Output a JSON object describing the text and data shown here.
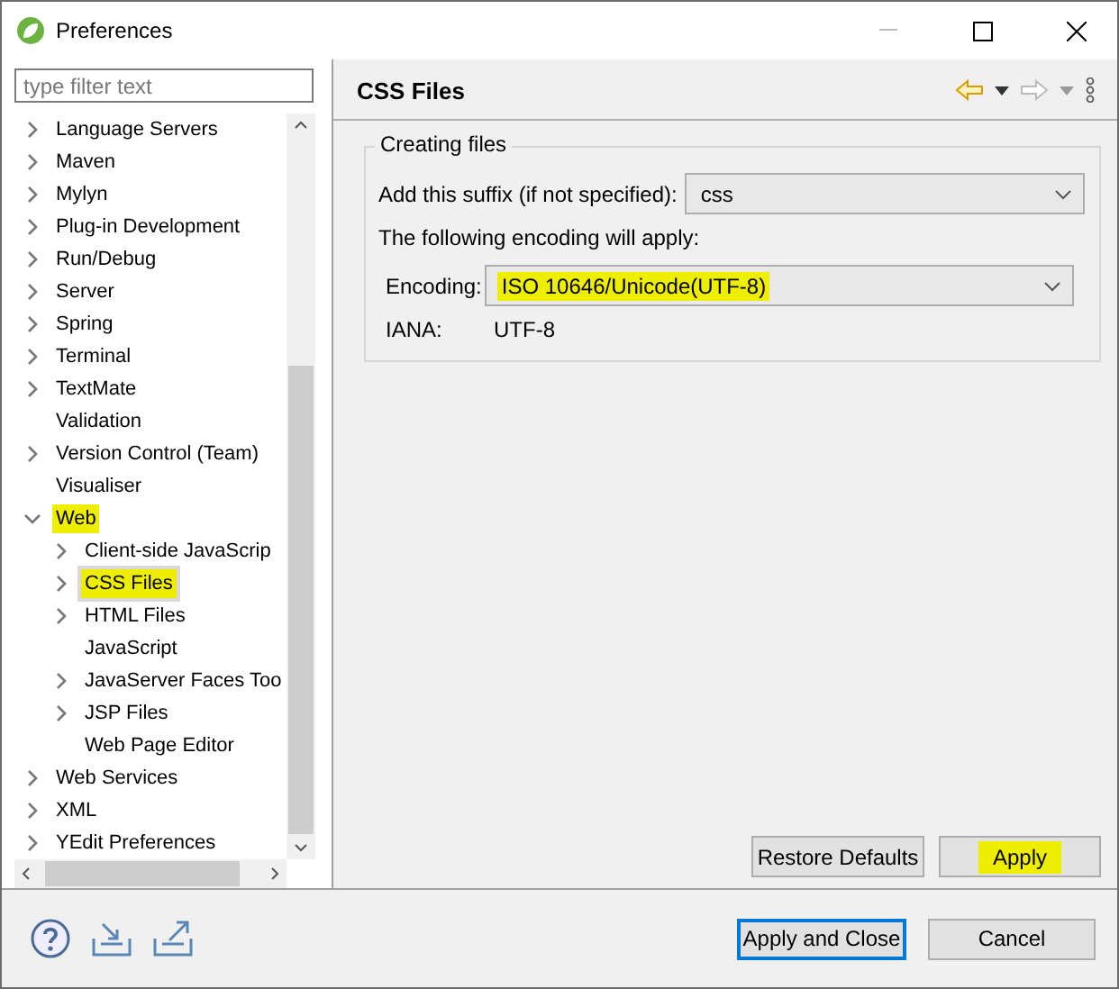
{
  "window": {
    "title": "Preferences"
  },
  "filter": {
    "placeholder": "type filter text"
  },
  "tree": [
    {
      "label": "Language Servers",
      "expandable": true,
      "selected": false,
      "highlighted": false
    },
    {
      "label": "Maven",
      "expandable": true,
      "selected": false,
      "highlighted": false
    },
    {
      "label": "Mylyn",
      "expandable": true,
      "selected": false,
      "highlighted": false
    },
    {
      "label": "Plug-in Development",
      "expandable": true,
      "selected": false,
      "highlighted": false
    },
    {
      "label": "Run/Debug",
      "expandable": true,
      "selected": false,
      "highlighted": false
    },
    {
      "label": "Server",
      "expandable": true,
      "selected": false,
      "highlighted": false
    },
    {
      "label": "Spring",
      "expandable": true,
      "selected": false,
      "highlighted": false
    },
    {
      "label": "Terminal",
      "expandable": true,
      "selected": false,
      "highlighted": false
    },
    {
      "label": "TextMate",
      "expandable": true,
      "selected": false,
      "highlighted": false
    },
    {
      "label": "Validation",
      "expandable": false,
      "selected": false,
      "highlighted": false
    },
    {
      "label": "Version Control (Team)",
      "expandable": true,
      "selected": false,
      "highlighted": false
    },
    {
      "label": "Visualiser",
      "expandable": false,
      "selected": false,
      "highlighted": false
    },
    {
      "label": "Web",
      "expandable": true,
      "expanded": true,
      "selected": false,
      "highlighted": true,
      "children": [
        {
          "label": "Client-side JavaScrip",
          "expandable": true,
          "selected": false,
          "highlighted": false
        },
        {
          "label": "CSS Files",
          "expandable": true,
          "selected": true,
          "highlighted": true
        },
        {
          "label": "HTML Files",
          "expandable": true,
          "selected": false,
          "highlighted": false
        },
        {
          "label": "JavaScript",
          "expandable": false,
          "selected": false,
          "highlighted": false
        },
        {
          "label": "JavaServer Faces Too",
          "expandable": true,
          "selected": false,
          "highlighted": false
        },
        {
          "label": "JSP Files",
          "expandable": true,
          "selected": false,
          "highlighted": false
        },
        {
          "label": "Web Page Editor",
          "expandable": false,
          "selected": false,
          "highlighted": false
        }
      ]
    },
    {
      "label": "Web Services",
      "expandable": true,
      "selected": false,
      "highlighted": false
    },
    {
      "label": "XML",
      "expandable": true,
      "selected": false,
      "highlighted": false
    },
    {
      "label": "YEdit Preferences",
      "expandable": true,
      "selected": false,
      "highlighted": false
    }
  ],
  "page": {
    "title": "CSS Files",
    "group": {
      "title": "Creating files",
      "suffix": {
        "label": "Add this suffix (if not specified):",
        "value": "css"
      },
      "note": "The following encoding will apply:",
      "encoding": {
        "label": "Encoding:",
        "value": "ISO 10646/Unicode(UTF-8)",
        "highlighted": true
      },
      "iana": {
        "label": "IANA:",
        "value": "UTF-8"
      }
    },
    "buttons": [
      {
        "label": "Restore Defaults",
        "highlighted": false
      },
      {
        "label": "Apply",
        "highlighted": true
      }
    ]
  },
  "footer_buttons": [
    {
      "label": "Apply and Close",
      "default": true
    },
    {
      "label": "Cancel",
      "default": false
    }
  ]
}
